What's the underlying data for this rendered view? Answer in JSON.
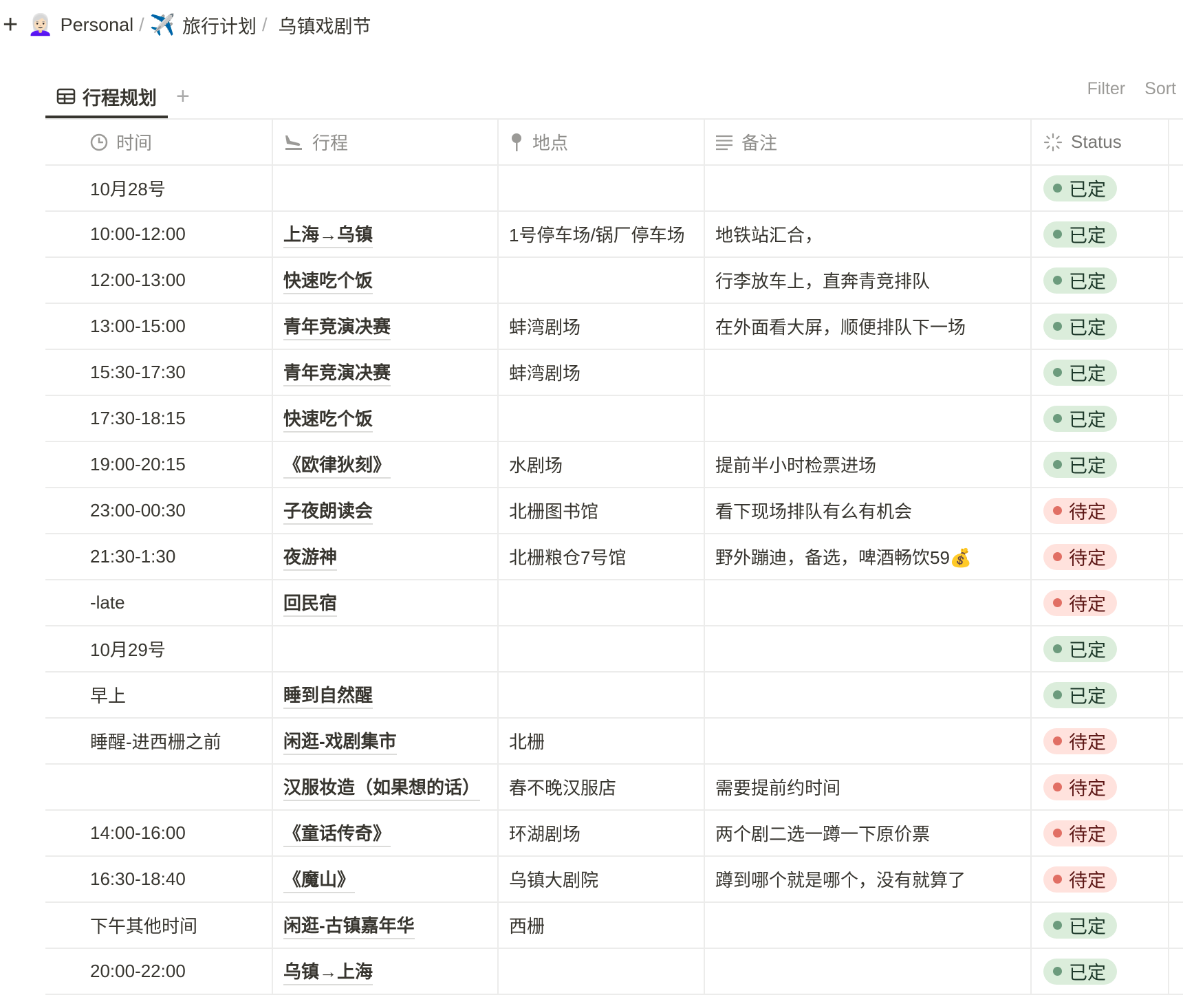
{
  "breadcrumb": {
    "items": [
      {
        "emoji": "👩🏻‍🦳",
        "label": "Personal"
      },
      {
        "emoji": "✈️",
        "label": "旅行计划"
      },
      {
        "emoji": "",
        "label": "乌镇戏剧节"
      }
    ],
    "separator": "/"
  },
  "view_tab": {
    "label": "行程规划",
    "add": "+"
  },
  "toolbar": {
    "filter": "Filter",
    "sort": "Sort"
  },
  "columns": [
    {
      "label": "时间",
      "icon": "clock-icon"
    },
    {
      "label": "行程",
      "icon": "plane-landing-icon"
    },
    {
      "label": "地点",
      "icon": "pin-icon"
    },
    {
      "label": "备注",
      "icon": "text-lines-icon"
    },
    {
      "label": "Status",
      "icon": "status-spinner-icon"
    }
  ],
  "status_colors": {
    "已定": "#dbeddb",
    "待定": "#ffe2dd"
  },
  "rows": [
    {
      "time": "10月28号",
      "title": "",
      "place": "",
      "note": "",
      "status": "已定"
    },
    {
      "time": "10:00-12:00",
      "title": "上海→乌镇",
      "place": "1号停车场/锅厂停车场",
      "note": "地铁站汇合，",
      "status": "已定"
    },
    {
      "time": "12:00-13:00",
      "title": "快速吃个饭",
      "place": "",
      "note": "行李放车上，直奔青竞排队",
      "status": "已定"
    },
    {
      "time": "13:00-15:00",
      "title": "青年竞演决赛",
      "place": "蚌湾剧场",
      "note": "在外面看大屏，顺便排队下一场",
      "status": "已定"
    },
    {
      "time": "15:30-17:30",
      "title": "青年竞演决赛",
      "place": "蚌湾剧场",
      "note": "",
      "status": "已定"
    },
    {
      "time": "17:30-18:15",
      "title": "快速吃个饭",
      "place": "",
      "note": "",
      "status": "已定"
    },
    {
      "time": "19:00-20:15",
      "title": "《欧律狄刻》",
      "place": "水剧场",
      "note": "提前半小时检票进场",
      "status": "已定"
    },
    {
      "time": "23:00-00:30",
      "title": "子夜朗读会",
      "place": "北栅图书馆",
      "note": "看下现场排队有么有机会",
      "status": "待定"
    },
    {
      "time": "21:30-1:30",
      "title": "夜游神",
      "place": "北栅粮仓7号馆",
      "note": "野外蹦迪，备选，啤酒畅饮59💰",
      "status": "待定"
    },
    {
      "time": "-late",
      "title": "回民宿",
      "place": "",
      "note": "",
      "status": "待定"
    },
    {
      "time": "10月29号",
      "title": "",
      "place": "",
      "note": "",
      "status": "已定"
    },
    {
      "time": "早上",
      "title": "睡到自然醒",
      "place": "",
      "note": "",
      "status": "已定"
    },
    {
      "time": "睡醒-进西栅之前",
      "title": "闲逛-戏剧集市",
      "place": "北栅",
      "note": "",
      "status": "待定"
    },
    {
      "time": "",
      "title": "汉服妆造（如果想的话）",
      "place": "春不晚汉服店",
      "note": "需要提前约时间",
      "status": "待定"
    },
    {
      "time": "14:00-16:00",
      "title": "《童话传奇》",
      "place": "环湖剧场",
      "note": "两个剧二选一蹲一下原价票",
      "status": "待定"
    },
    {
      "time": "16:30-18:40",
      "title": "《魔山》",
      "place": "乌镇大剧院",
      "note": "蹲到哪个就是哪个，没有就算了",
      "status": "待定"
    },
    {
      "time": "下午其他时间",
      "title": "闲逛-古镇嘉年华",
      "place": "西栅",
      "note": "",
      "status": "已定"
    },
    {
      "time": "20:00-22:00",
      "title": "乌镇→上海",
      "place": "",
      "note": "",
      "status": "已定"
    }
  ]
}
